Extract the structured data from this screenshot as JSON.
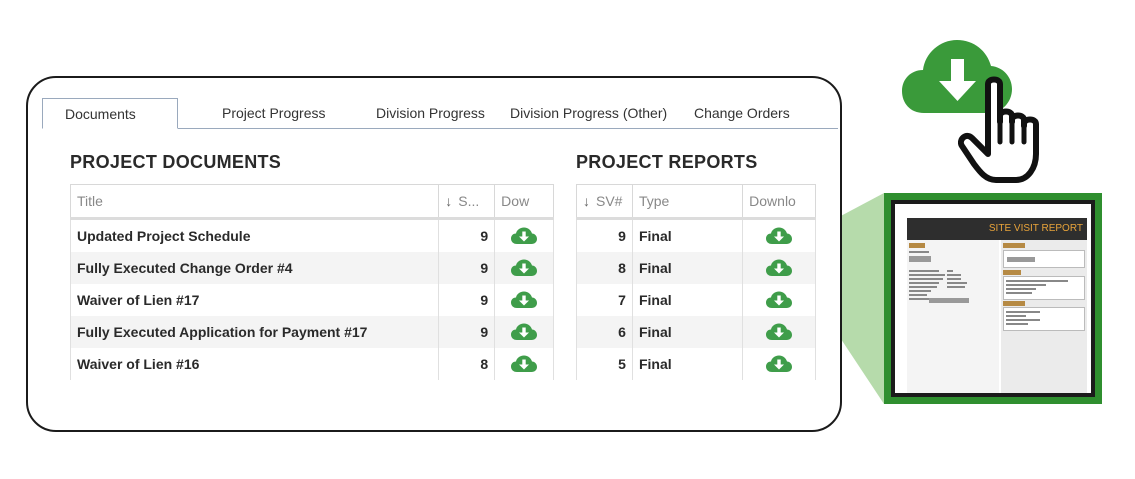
{
  "tabs": [
    {
      "label": "Documents",
      "active": true
    },
    {
      "label": "Project Progress"
    },
    {
      "label": "Division Progress"
    },
    {
      "label": "Division Progress (Other)"
    },
    {
      "label": "Change Orders"
    }
  ],
  "documents": {
    "title": "PROJECT DOCUMENTS",
    "columns": {
      "title": "Title",
      "sv": "S...",
      "download": "Dow"
    },
    "sort_arrow": "↓",
    "rows": [
      {
        "title": "Updated Project Schedule",
        "sv": "9"
      },
      {
        "title": "Fully Executed Change Order #4",
        "sv": "9"
      },
      {
        "title": "Waiver of Lien #17",
        "sv": "9"
      },
      {
        "title": "Fully Executed Application for Payment #17",
        "sv": "9"
      },
      {
        "title": "Waiver of Lien #16",
        "sv": "8"
      }
    ]
  },
  "reports": {
    "title": "PROJECT REPORTS",
    "columns": {
      "sv": "SV#",
      "type": "Type",
      "download": "Downlo"
    },
    "sort_arrow": "↓",
    "rows": [
      {
        "sv": "9",
        "type": "Final"
      },
      {
        "sv": "8",
        "type": "Final"
      },
      {
        "sv": "7",
        "type": "Final"
      },
      {
        "sv": "6",
        "type": "Final"
      },
      {
        "sv": "5",
        "type": "Final"
      }
    ]
  },
  "report_preview": {
    "title": "SITE VISIT REPORT"
  },
  "colors": {
    "accent_green": "#3a9a3a",
    "icon_green": "#3f9d4a",
    "report_orange": "#e8a33a",
    "wedge_green": "#a9d59c"
  },
  "icons": {
    "download": "cloud-download-icon",
    "pointer": "hand-pointer-icon"
  }
}
